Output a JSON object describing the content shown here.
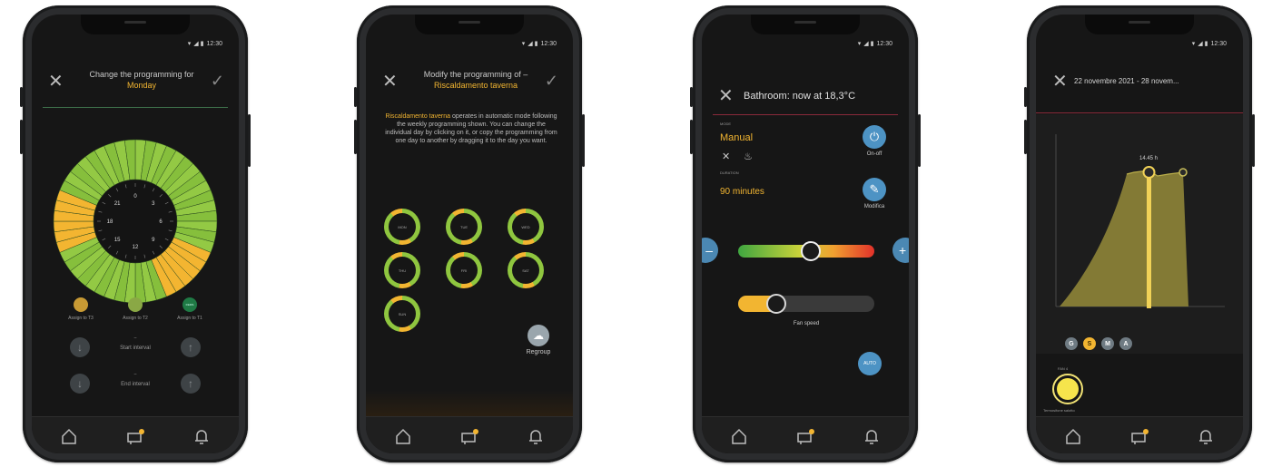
{
  "status": {
    "time": "12:30"
  },
  "phone1": {
    "title_line1": "Change the programming for",
    "title_day": "Monday",
    "clock_numbers": [
      "0",
      "3",
      "6",
      "9",
      "12",
      "15",
      "18",
      "21"
    ],
    "legend": [
      "Assign to T3",
      "Assign to T2",
      "Assign to T1"
    ],
    "legend_chip_label": "DEMS",
    "start_value": "–",
    "start_label": "Start interval",
    "end_value": "–",
    "end_label": "End interval"
  },
  "phone2": {
    "title_line1": "Modify the programming of –",
    "title_name": "Riscaldamento taverna",
    "desc_name": "Riscaldamento taverna",
    "desc_text": " operates in automatic mode following the weekly programming shown. You can change the individual day by clicking on it, or copy the programming from one day to another by dragging it to the day you want.",
    "days": [
      "MON",
      "TUE",
      "WED",
      "THU",
      "FRI",
      "SAT",
      "SUN"
    ],
    "regroup_label": "Regroup"
  },
  "phone3": {
    "title": "Bathroom: now at 18,3°C",
    "mode_caption": "MODE",
    "mode_value": "Manual",
    "onoff_label": "On-off",
    "duration_caption": "DURATION",
    "duration_value": "90 minutes",
    "modify_label": "Modifica",
    "minus": "–",
    "plus": "+",
    "fan_label": "Fan speed",
    "auto_label": "AUTO",
    "temperature_slider_level": 0.53,
    "fan_slider_level": 0.28
  },
  "phone4": {
    "title": "22 novembre 2021 - 28 novem...",
    "peak_label": "14.45 h",
    "period_chips": [
      "G",
      "S",
      "M",
      "A"
    ],
    "selected_period": "S",
    "device_caption": "FAN 4",
    "device_label": "Termosifone salotto"
  },
  "colors": {
    "accent": "#f2b531",
    "green": "#8fc63f",
    "screen": "#161616"
  }
}
